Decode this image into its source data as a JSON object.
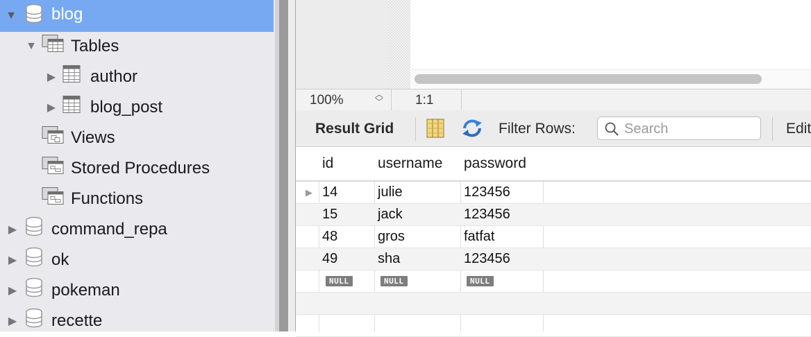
{
  "sidebar": {
    "items": [
      {
        "label": "blog",
        "type": "schema",
        "expanded": true,
        "selected": true
      },
      {
        "label": "Tables",
        "type": "folder",
        "expanded": true
      },
      {
        "label": "author",
        "type": "table"
      },
      {
        "label": "blog_post",
        "type": "table"
      },
      {
        "label": "Views",
        "type": "folder"
      },
      {
        "label": "Stored Procedures",
        "type": "folder"
      },
      {
        "label": "Functions",
        "type": "folder"
      },
      {
        "label": "command_repa",
        "type": "schema"
      },
      {
        "label": "ok",
        "type": "schema"
      },
      {
        "label": "pokeman",
        "type": "schema"
      },
      {
        "label": "recette",
        "type": "schema"
      }
    ]
  },
  "statusbar": {
    "zoom": "100%",
    "cursor": "1:1"
  },
  "toolbar": {
    "result_grid_label": "Result Grid",
    "filter_label": "Filter Rows:",
    "search_placeholder": "Search",
    "search_value": "",
    "edit_label": "Edit"
  },
  "grid": {
    "columns": [
      "id",
      "username",
      "password"
    ],
    "rows": [
      [
        "14",
        "julie",
        "123456"
      ],
      [
        "15",
        "jack",
        "123456"
      ],
      [
        "48",
        "gros",
        "fatfat"
      ],
      [
        "49",
        "sha",
        "123456"
      ]
    ],
    "null_label": "NULL"
  },
  "colors": {
    "selection": "#77a9f3",
    "sidebar_bg": "#e9e9ee",
    "refresh_icon": "#3b82d8"
  }
}
